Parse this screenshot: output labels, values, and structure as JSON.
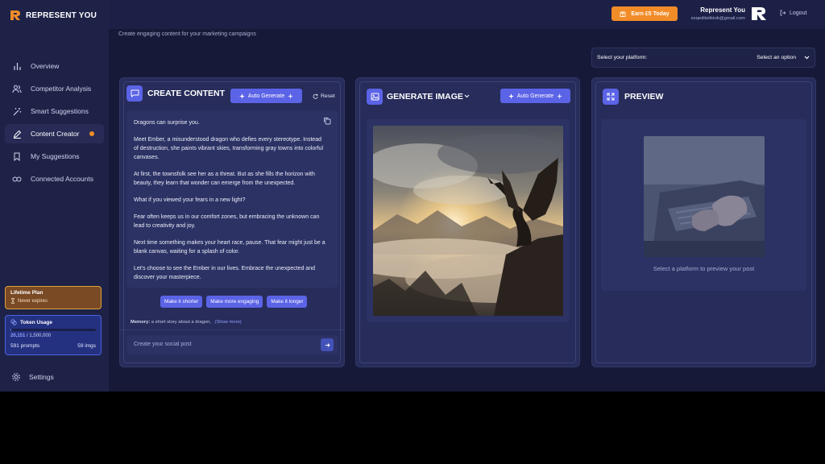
{
  "brand": {
    "name": "REPRESENT YOU",
    "logo_color": "#f28c28"
  },
  "sidebar": {
    "items": [
      {
        "label": "Overview",
        "icon": "bar-chart-icon"
      },
      {
        "label": "Competitor Analysis",
        "icon": "users-icon"
      },
      {
        "label": "Smart Suggestions",
        "icon": "magic-wand-icon"
      },
      {
        "label": "Content Creator",
        "icon": "pencil-icon",
        "active": true,
        "badge": "orange-dot"
      },
      {
        "label": "My Suggestions",
        "icon": "bookmark-icon"
      },
      {
        "label": "Connected Accounts",
        "icon": "link-icon"
      }
    ],
    "plan": {
      "title": "Lifetime Plan",
      "status": "Never expires"
    },
    "tokens": {
      "title": "Token Usage",
      "used": "20,151",
      "total": "/ 1,500,000",
      "fraction_used": 0.013,
      "prompts": "591 prompts",
      "images": "59 imgs"
    },
    "settings_label": "Settings"
  },
  "topbar": {
    "earn_label": "Earn £5 Today",
    "user_name": "Represent You",
    "user_email": "exqeditstiktok@gmail.com",
    "logout_label": "Logout"
  },
  "page": {
    "subtitle": "Create engaging content for your marketing campaigns"
  },
  "platform": {
    "label": "Select your platform:",
    "value": "Select an option"
  },
  "create": {
    "title": "CREATE CONTENT",
    "auto_label": "Auto Generate",
    "reset_label": "Reset",
    "paragraphs": [
      "Dragons can surprise you.",
      "Meet Ember, a misunderstood dragon who defies every stereotype. Instead of destruction, she paints vibrant skies, transforming gray towns into colorful canvases.",
      "At first, the townsfolk see her as a threat. But as she fills the horizon with beauty, they learn that wonder can emerge from the unexpected.",
      "What if you viewed your fears in a new light?",
      "Fear often keeps us in our comfort zones, but embracing the unknown can lead to creativity and joy.",
      "Next time something makes your heart race, pause. That fear might just be a blank canvas, waiting for a splash of color.",
      "Let's choose to see the Ember in our lives. Embrace the unexpected and discover your masterpiece."
    ],
    "chips": [
      "Make it shorter",
      "Make more engaging",
      "Make it longer"
    ],
    "memory_label": "Memory:",
    "memory_text": "a short story about a dragon,",
    "show_more": "(Show more)",
    "post_placeholder": "Create your social post"
  },
  "image": {
    "title": "GENERATE IMAGE",
    "auto_label": "Auto Generate"
  },
  "preview": {
    "title": "PREVIEW",
    "hint": "Select a platform to preview your post"
  },
  "colors": {
    "accent": "#5b63e6",
    "orange": "#f28c28",
    "card": "#272c5a",
    "bg": "#161a38"
  }
}
